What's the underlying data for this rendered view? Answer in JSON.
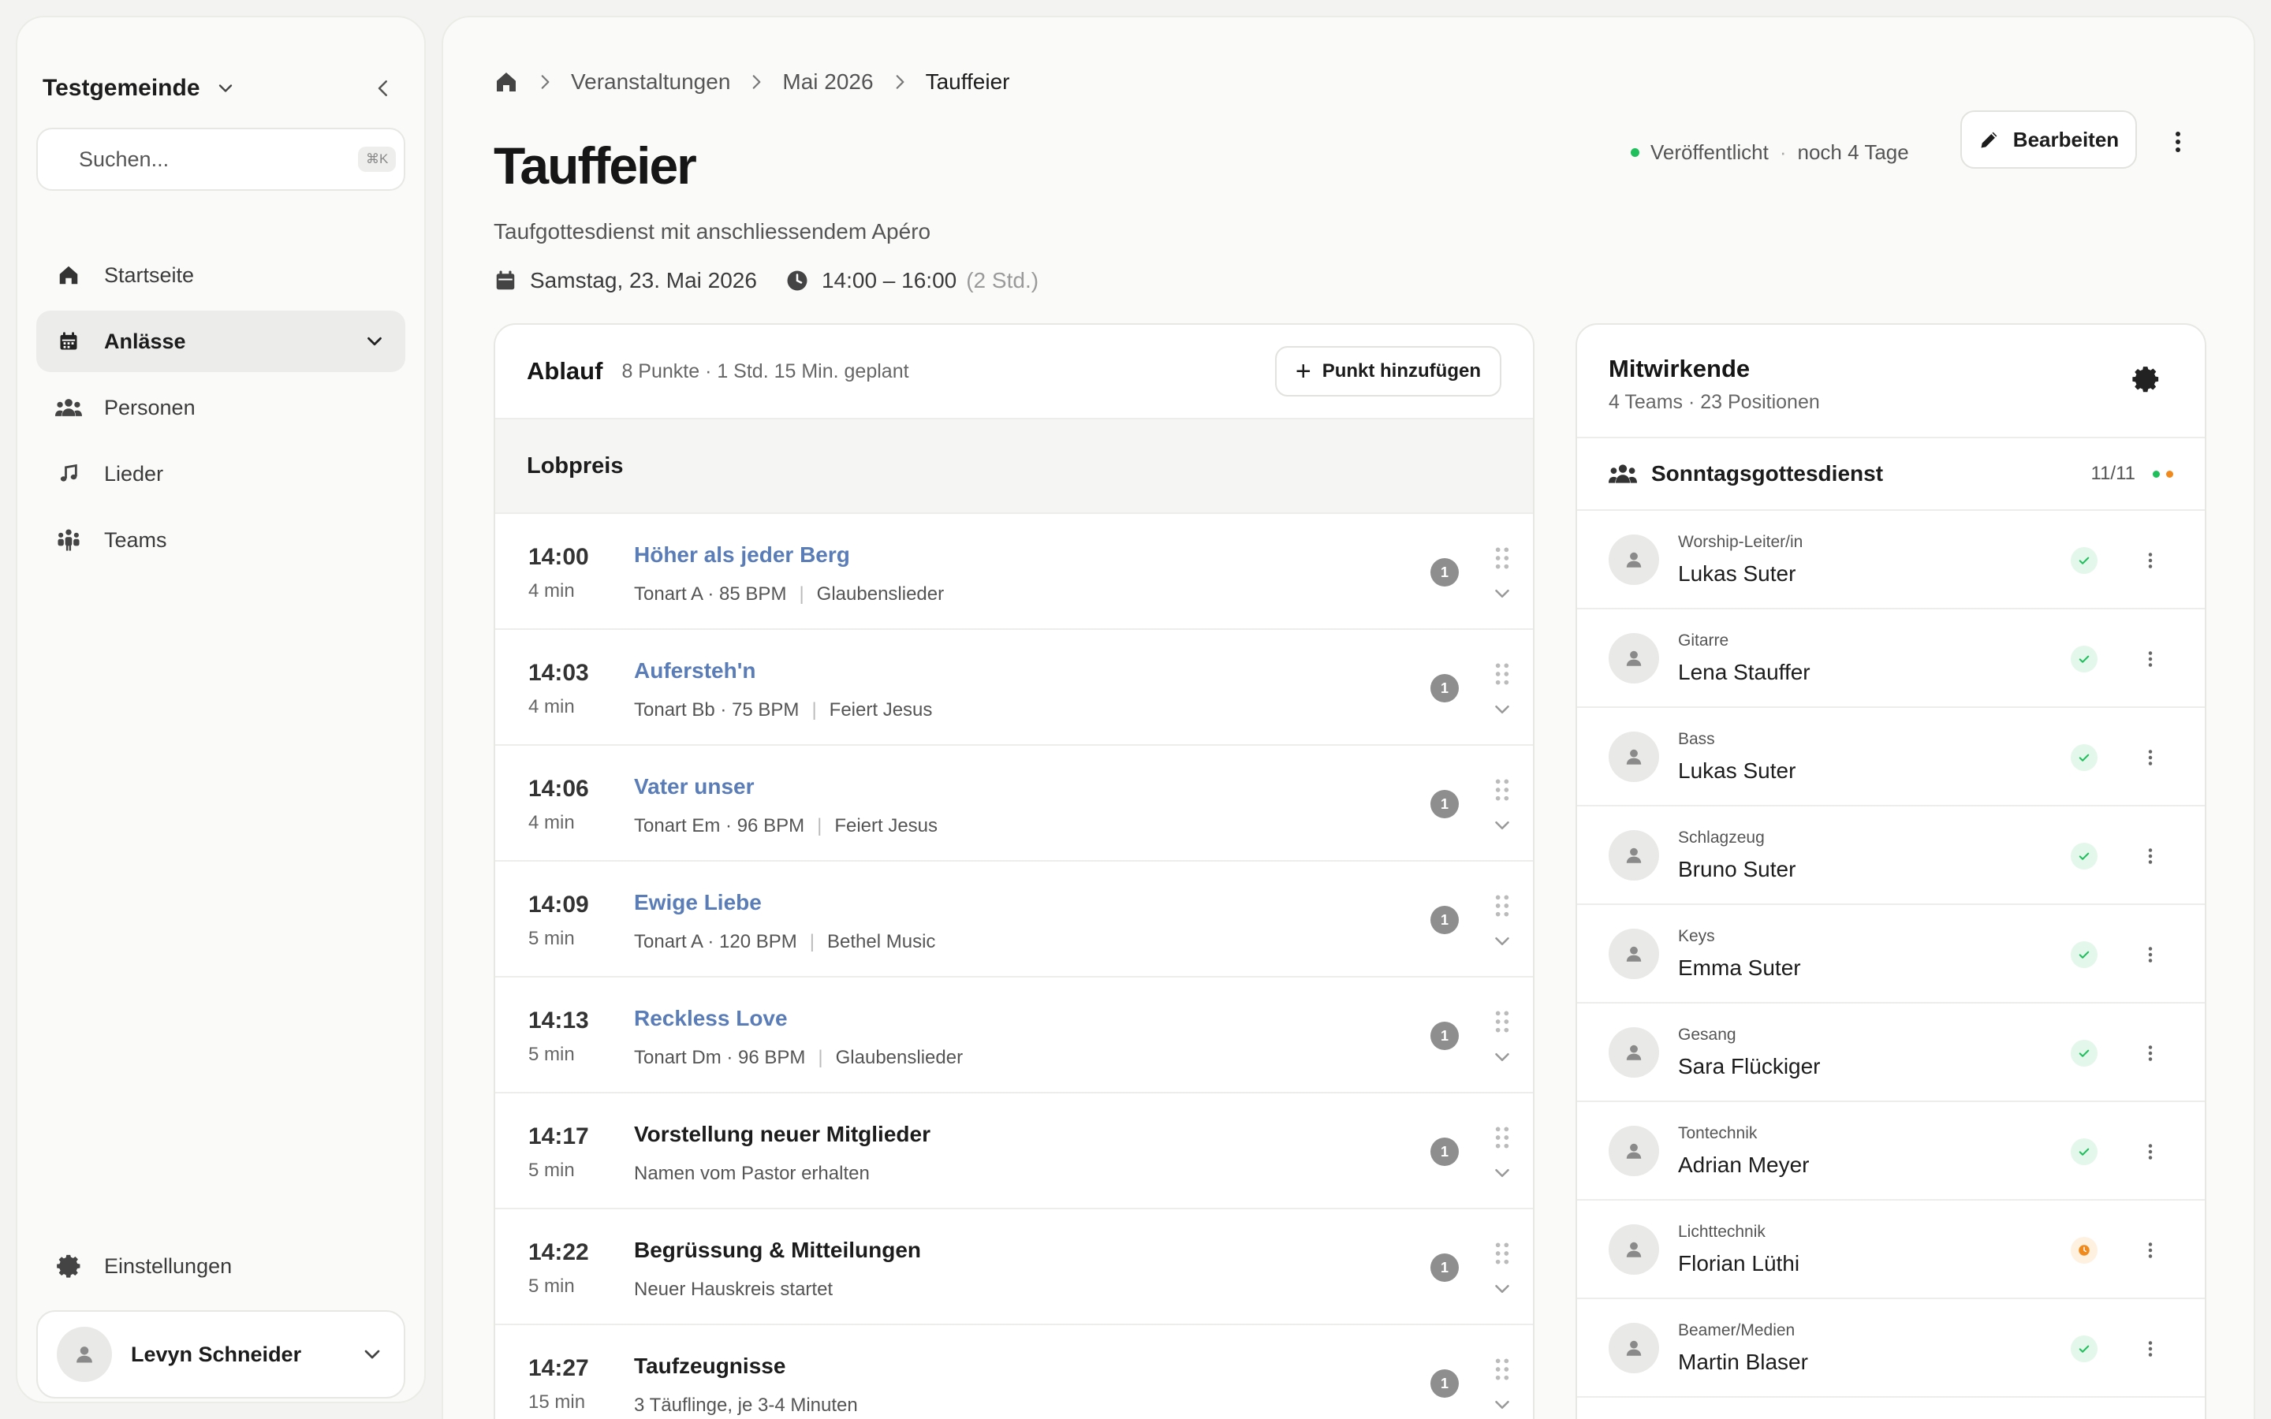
{
  "sidebar": {
    "workspace": "Testgemeinde",
    "search": {
      "placeholder": "Suchen...",
      "shortcut": "⌘K"
    },
    "nav": [
      {
        "label": "Startseite",
        "icon": "home-icon"
      },
      {
        "label": "Anlässe",
        "icon": "calendar-icon",
        "active": true
      },
      {
        "label": "Personen",
        "icon": "users-icon"
      },
      {
        "label": "Lieder",
        "icon": "music-icon"
      },
      {
        "label": "Teams",
        "icon": "team-icon"
      }
    ],
    "settings": "Einstellungen",
    "user": "Levyn Schneider"
  },
  "breadcrumb": {
    "items": [
      "Veranstaltungen",
      "Mai 2026"
    ],
    "current": "Tauffeier"
  },
  "event": {
    "title": "Tauffeier",
    "subtitle": "Taufgottesdienst mit anschliessendem Apéro",
    "date": "Samstag, 23. Mai 2026",
    "time": "14:00 – 16:00",
    "duration": "(2 Std.)",
    "status": "Veröffentlicht",
    "status_sep": "·",
    "countdown": "noch 4 Tage",
    "edit_label": "Bearbeiten"
  },
  "colors": {
    "song_link": "#5a7db8",
    "status_ok": "#1fbf5c",
    "status_pending": "#f08a1c"
  },
  "ablauf": {
    "title": "Ablauf",
    "summary": "8 Punkte · 1 Std. 15 Min. geplant",
    "add_label": "Punkt hinzufügen",
    "section": "Lobpreis",
    "items": [
      {
        "time": "14:00",
        "dur": "4 min",
        "title": "Höher als jeder Berg",
        "meta": "Tonart A · 85 BPM",
        "source": "Glaubenslieder",
        "badge": "1",
        "song": true
      },
      {
        "time": "14:03",
        "dur": "4 min",
        "title": "Aufersteh'n",
        "meta": "Tonart Bb · 75 BPM",
        "source": "Feiert Jesus",
        "badge": "1",
        "song": true
      },
      {
        "time": "14:06",
        "dur": "4 min",
        "title": "Vater unser",
        "meta": "Tonart Em · 96 BPM",
        "source": "Feiert Jesus",
        "badge": "1",
        "song": true
      },
      {
        "time": "14:09",
        "dur": "5 min",
        "title": "Ewige Liebe",
        "meta": "Tonart A · 120 BPM",
        "source": "Bethel Music",
        "badge": "1",
        "song": true
      },
      {
        "time": "14:13",
        "dur": "5 min",
        "title": "Reckless Love",
        "meta": "Tonart Dm · 96 BPM",
        "source": "Glaubenslieder",
        "badge": "1",
        "song": true
      },
      {
        "time": "14:17",
        "dur": "5 min",
        "title": "Vorstellung neuer Mitglieder",
        "meta": "Namen vom Pastor erhalten",
        "source": "",
        "badge": "1",
        "song": false
      },
      {
        "time": "14:22",
        "dur": "5 min",
        "title": "Begrüssung & Mitteilungen",
        "meta": "Neuer Hauskreis startet",
        "source": "",
        "badge": "1",
        "song": false
      },
      {
        "time": "14:27",
        "dur": "15 min",
        "title": "Taufzeugnisse",
        "meta": "3 Täuflinge, je 3-4 Minuten",
        "source": "",
        "badge": "1",
        "song": false
      }
    ]
  },
  "mitwirkende": {
    "title": "Mitwirkende",
    "summary": "4 Teams · 23 Positionen",
    "team": {
      "name": "Sonntagsgottesdienst",
      "count": "11/11"
    },
    "positions": [
      {
        "role": "Worship-Leiter/in",
        "name": "Lukas Suter",
        "status": "ok"
      },
      {
        "role": "Gitarre",
        "name": "Lena Stauffer",
        "status": "ok"
      },
      {
        "role": "Bass",
        "name": "Lukas Suter",
        "status": "ok"
      },
      {
        "role": "Schlagzeug",
        "name": "Bruno Suter",
        "status": "ok"
      },
      {
        "role": "Keys",
        "name": "Emma Suter",
        "status": "ok"
      },
      {
        "role": "Gesang",
        "name": "Sara Flückiger",
        "status": "ok"
      },
      {
        "role": "Tontechnik",
        "name": "Adrian Meyer",
        "status": "ok"
      },
      {
        "role": "Lichttechnik",
        "name": "Florian Lüthi",
        "status": "pending"
      },
      {
        "role": "Beamer/Medien",
        "name": "Martin Blaser",
        "status": "ok"
      }
    ]
  }
}
